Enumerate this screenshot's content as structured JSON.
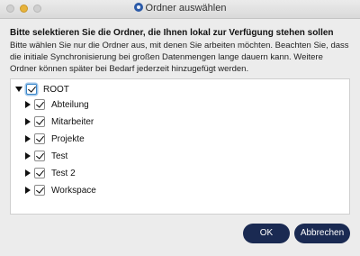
{
  "window": {
    "title": "Ordner auswählen"
  },
  "headline": "Bitte selektieren Sie die Ordner, die Ihnen lokal zur Verfügung stehen sollen",
  "description": "Bitte wählen Sie nur die Ordner aus, mit denen Sie arbeiten möchten. Beachten Sie, dass die initiale Synchronisierung bei großen Datenmengen lange dauern kann. Weitere Ordner können später bei Bedarf jederzeit hinzugefügt werden.",
  "tree": {
    "root": {
      "label": "ROOT",
      "checked": true,
      "expanded": true
    },
    "children": [
      {
        "label": "Abteilung",
        "checked": true,
        "expanded": false
      },
      {
        "label": "Mitarbeiter",
        "checked": true,
        "expanded": false
      },
      {
        "label": "Projekte",
        "checked": true,
        "expanded": false
      },
      {
        "label": "Test",
        "checked": true,
        "expanded": false
      },
      {
        "label": "Test 2",
        "checked": true,
        "expanded": false
      },
      {
        "label": "Workspace",
        "checked": true,
        "expanded": false
      }
    ]
  },
  "buttons": {
    "ok": "OK",
    "cancel": "Abbrechen"
  },
  "colors": {
    "button_bg": "#1a2a52",
    "root_focus": "#3a86c8"
  }
}
